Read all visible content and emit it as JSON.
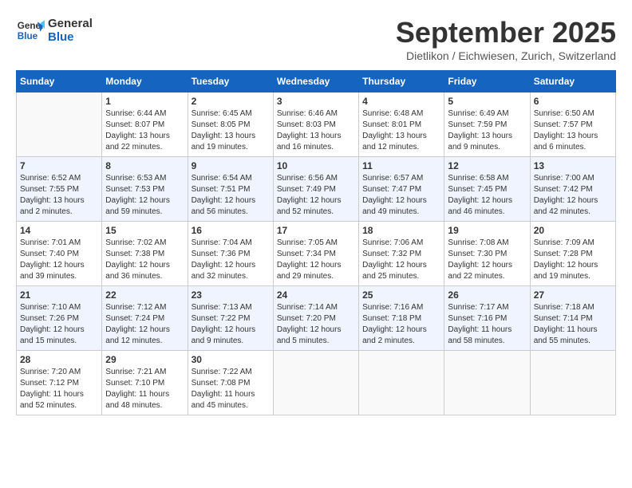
{
  "logo": {
    "line1": "General",
    "line2": "Blue"
  },
  "title": "September 2025",
  "location": "Dietlikon / Eichwiesen, Zurich, Switzerland",
  "weekdays": [
    "Sunday",
    "Monday",
    "Tuesday",
    "Wednesday",
    "Thursday",
    "Friday",
    "Saturday"
  ],
  "weeks": [
    [
      {
        "day": "",
        "sunrise": "",
        "sunset": "",
        "daylight": ""
      },
      {
        "day": "1",
        "sunrise": "Sunrise: 6:44 AM",
        "sunset": "Sunset: 8:07 PM",
        "daylight": "Daylight: 13 hours and 22 minutes."
      },
      {
        "day": "2",
        "sunrise": "Sunrise: 6:45 AM",
        "sunset": "Sunset: 8:05 PM",
        "daylight": "Daylight: 13 hours and 19 minutes."
      },
      {
        "day": "3",
        "sunrise": "Sunrise: 6:46 AM",
        "sunset": "Sunset: 8:03 PM",
        "daylight": "Daylight: 13 hours and 16 minutes."
      },
      {
        "day": "4",
        "sunrise": "Sunrise: 6:48 AM",
        "sunset": "Sunset: 8:01 PM",
        "daylight": "Daylight: 13 hours and 12 minutes."
      },
      {
        "day": "5",
        "sunrise": "Sunrise: 6:49 AM",
        "sunset": "Sunset: 7:59 PM",
        "daylight": "Daylight: 13 hours and 9 minutes."
      },
      {
        "day": "6",
        "sunrise": "Sunrise: 6:50 AM",
        "sunset": "Sunset: 7:57 PM",
        "daylight": "Daylight: 13 hours and 6 minutes."
      }
    ],
    [
      {
        "day": "7",
        "sunrise": "Sunrise: 6:52 AM",
        "sunset": "Sunset: 7:55 PM",
        "daylight": "Daylight: 13 hours and 2 minutes."
      },
      {
        "day": "8",
        "sunrise": "Sunrise: 6:53 AM",
        "sunset": "Sunset: 7:53 PM",
        "daylight": "Daylight: 12 hours and 59 minutes."
      },
      {
        "day": "9",
        "sunrise": "Sunrise: 6:54 AM",
        "sunset": "Sunset: 7:51 PM",
        "daylight": "Daylight: 12 hours and 56 minutes."
      },
      {
        "day": "10",
        "sunrise": "Sunrise: 6:56 AM",
        "sunset": "Sunset: 7:49 PM",
        "daylight": "Daylight: 12 hours and 52 minutes."
      },
      {
        "day": "11",
        "sunrise": "Sunrise: 6:57 AM",
        "sunset": "Sunset: 7:47 PM",
        "daylight": "Daylight: 12 hours and 49 minutes."
      },
      {
        "day": "12",
        "sunrise": "Sunrise: 6:58 AM",
        "sunset": "Sunset: 7:45 PM",
        "daylight": "Daylight: 12 hours and 46 minutes."
      },
      {
        "day": "13",
        "sunrise": "Sunrise: 7:00 AM",
        "sunset": "Sunset: 7:42 PM",
        "daylight": "Daylight: 12 hours and 42 minutes."
      }
    ],
    [
      {
        "day": "14",
        "sunrise": "Sunrise: 7:01 AM",
        "sunset": "Sunset: 7:40 PM",
        "daylight": "Daylight: 12 hours and 39 minutes."
      },
      {
        "day": "15",
        "sunrise": "Sunrise: 7:02 AM",
        "sunset": "Sunset: 7:38 PM",
        "daylight": "Daylight: 12 hours and 36 minutes."
      },
      {
        "day": "16",
        "sunrise": "Sunrise: 7:04 AM",
        "sunset": "Sunset: 7:36 PM",
        "daylight": "Daylight: 12 hours and 32 minutes."
      },
      {
        "day": "17",
        "sunrise": "Sunrise: 7:05 AM",
        "sunset": "Sunset: 7:34 PM",
        "daylight": "Daylight: 12 hours and 29 minutes."
      },
      {
        "day": "18",
        "sunrise": "Sunrise: 7:06 AM",
        "sunset": "Sunset: 7:32 PM",
        "daylight": "Daylight: 12 hours and 25 minutes."
      },
      {
        "day": "19",
        "sunrise": "Sunrise: 7:08 AM",
        "sunset": "Sunset: 7:30 PM",
        "daylight": "Daylight: 12 hours and 22 minutes."
      },
      {
        "day": "20",
        "sunrise": "Sunrise: 7:09 AM",
        "sunset": "Sunset: 7:28 PM",
        "daylight": "Daylight: 12 hours and 19 minutes."
      }
    ],
    [
      {
        "day": "21",
        "sunrise": "Sunrise: 7:10 AM",
        "sunset": "Sunset: 7:26 PM",
        "daylight": "Daylight: 12 hours and 15 minutes."
      },
      {
        "day": "22",
        "sunrise": "Sunrise: 7:12 AM",
        "sunset": "Sunset: 7:24 PM",
        "daylight": "Daylight: 12 hours and 12 minutes."
      },
      {
        "day": "23",
        "sunrise": "Sunrise: 7:13 AM",
        "sunset": "Sunset: 7:22 PM",
        "daylight": "Daylight: 12 hours and 9 minutes."
      },
      {
        "day": "24",
        "sunrise": "Sunrise: 7:14 AM",
        "sunset": "Sunset: 7:20 PM",
        "daylight": "Daylight: 12 hours and 5 minutes."
      },
      {
        "day": "25",
        "sunrise": "Sunrise: 7:16 AM",
        "sunset": "Sunset: 7:18 PM",
        "daylight": "Daylight: 12 hours and 2 minutes."
      },
      {
        "day": "26",
        "sunrise": "Sunrise: 7:17 AM",
        "sunset": "Sunset: 7:16 PM",
        "daylight": "Daylight: 11 hours and 58 minutes."
      },
      {
        "day": "27",
        "sunrise": "Sunrise: 7:18 AM",
        "sunset": "Sunset: 7:14 PM",
        "daylight": "Daylight: 11 hours and 55 minutes."
      }
    ],
    [
      {
        "day": "28",
        "sunrise": "Sunrise: 7:20 AM",
        "sunset": "Sunset: 7:12 PM",
        "daylight": "Daylight: 11 hours and 52 minutes."
      },
      {
        "day": "29",
        "sunrise": "Sunrise: 7:21 AM",
        "sunset": "Sunset: 7:10 PM",
        "daylight": "Daylight: 11 hours and 48 minutes."
      },
      {
        "day": "30",
        "sunrise": "Sunrise: 7:22 AM",
        "sunset": "Sunset: 7:08 PM",
        "daylight": "Daylight: 11 hours and 45 minutes."
      },
      {
        "day": "",
        "sunrise": "",
        "sunset": "",
        "daylight": ""
      },
      {
        "day": "",
        "sunrise": "",
        "sunset": "",
        "daylight": ""
      },
      {
        "day": "",
        "sunrise": "",
        "sunset": "",
        "daylight": ""
      },
      {
        "day": "",
        "sunrise": "",
        "sunset": "",
        "daylight": ""
      }
    ]
  ]
}
